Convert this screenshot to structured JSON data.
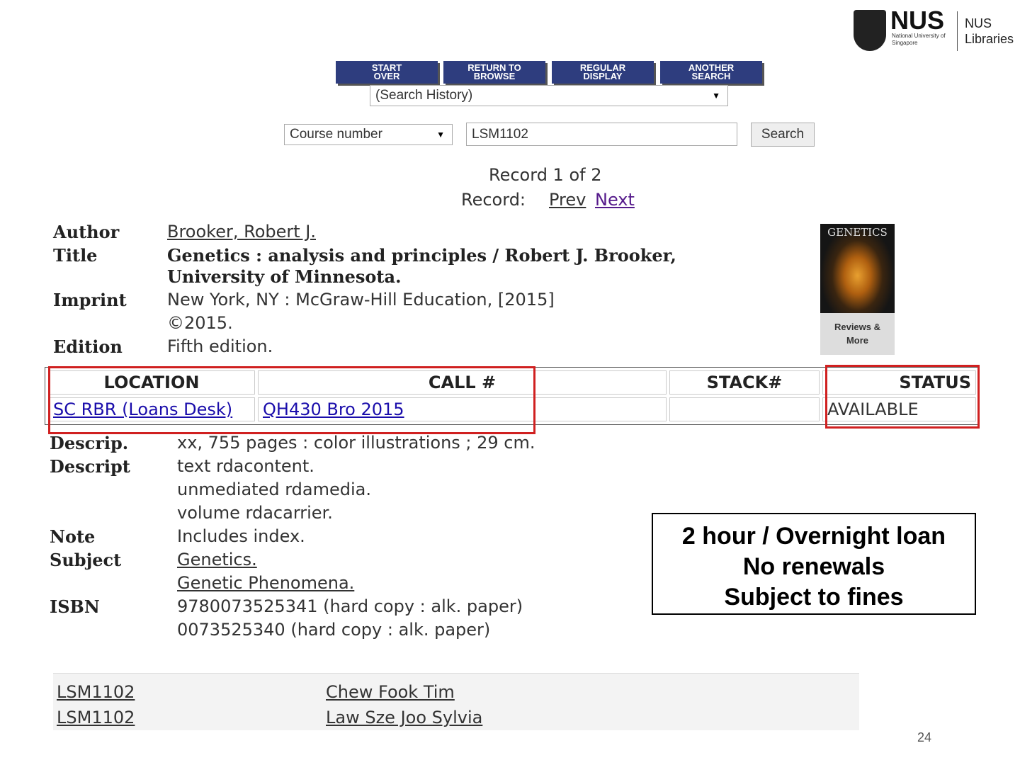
{
  "logo": {
    "nus": "NUS",
    "university": "National University of Singapore",
    "libraries": "NUS Libraries"
  },
  "nav": [
    "Start\nOver",
    "Return to\nBrowse",
    "Regular\nDisplay",
    "Another\nSearch"
  ],
  "search_history": "(Search History)",
  "search": {
    "type": "Course number",
    "query": "LSM1102",
    "button": "Search"
  },
  "record": {
    "position": "Record 1 of 2",
    "label": "Record:",
    "prev": "Prev",
    "next": "Next"
  },
  "bib": {
    "author_label": "Author",
    "author": "Brooker, Robert J.",
    "title_label": "Title",
    "title1": "Genetics : analysis and principles / Robert J. Brooker,",
    "title2": "University of Minnesota.",
    "imprint_label": "Imprint",
    "imprint1": "New York, NY : McGraw-Hill Education, [2015]",
    "imprint2": "©2015.",
    "edition_label": "Edition",
    "edition": "Fifth edition."
  },
  "cover": {
    "title": "GENETICS",
    "reviews": "Reviews & More"
  },
  "holdings": {
    "headers": [
      "LOCATION",
      "CALL #",
      "STACK#",
      "STATUS"
    ],
    "row": {
      "location": "SC RBR (Loans Desk)",
      "call": "QH430 Bro 2015",
      "stack": "",
      "status": "AVAILABLE"
    }
  },
  "details": [
    {
      "label": "Descrip.",
      "value": "xx, 755 pages : color illustrations ; 29 cm."
    },
    {
      "label": "Descript",
      "value": "text rdacontent."
    },
    {
      "label": "",
      "value": "unmediated rdamedia."
    },
    {
      "label": "",
      "value": "volume rdacarrier."
    },
    {
      "label": "Note",
      "value": "Includes index."
    },
    {
      "label": "Subject",
      "value": "Genetics.",
      "link": true
    },
    {
      "label": "",
      "value": "Genetic Phenomena.",
      "link": true
    },
    {
      "label": "ISBN",
      "value": "9780073525341 (hard copy : alk. paper)"
    },
    {
      "label": "",
      "value": "0073525340 (hard copy : alk. paper)"
    }
  ],
  "courses": [
    {
      "code": "LSM1102",
      "instructor": "Chew Fook Tim"
    },
    {
      "code": "LSM1102",
      "instructor": "Law Sze Joo Sylvia"
    }
  ],
  "callout": [
    "2 hour / Overnight loan",
    "No renewals",
    "Subject to fines"
  ],
  "page_number": "24"
}
